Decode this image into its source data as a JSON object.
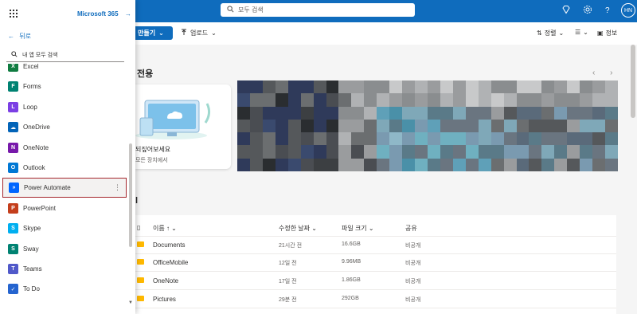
{
  "topbar": {
    "search_placeholder": "모두 검색",
    "avatar_initials": "HN",
    "icons": [
      "diamond-icon",
      "gear-icon",
      "help-icon"
    ]
  },
  "launcher": {
    "m365_label": "Microsoft 365",
    "m365_arrow": "→",
    "back_label": "뒤로",
    "search_placeholder": "내 앱 모두 검색",
    "apps": [
      {
        "label": "Excel",
        "color": "#107c41",
        "glyph": "X"
      },
      {
        "label": "Forms",
        "color": "#008272",
        "glyph": "F"
      },
      {
        "label": "Loop",
        "color": "#7b3fe4",
        "glyph": "L"
      },
      {
        "label": "OneDrive",
        "color": "#0364b8",
        "glyph": "☁"
      },
      {
        "label": "OneNote",
        "color": "#7719aa",
        "glyph": "N"
      },
      {
        "label": "Outlook",
        "color": "#0078d4",
        "glyph": "O"
      },
      {
        "label": "Power Automate",
        "color": "#0066ff",
        "glyph": "»"
      },
      {
        "label": "PowerPoint",
        "color": "#c43e1c",
        "glyph": "P"
      },
      {
        "label": "Skype",
        "color": "#00aff0",
        "glyph": "S"
      },
      {
        "label": "Sway",
        "color": "#008272",
        "glyph": "S"
      },
      {
        "label": "Teams",
        "color": "#5059c9",
        "glyph": "T"
      },
      {
        "label": "To Do",
        "color": "#2564cf",
        "glyph": "✓"
      }
    ],
    "more_glyph": "⋮"
  },
  "cmdbar": {
    "create_label": "만들기",
    "create_caret": "⌄",
    "upload_label": "업로드",
    "upload_caret": "⌄",
    "sort_label": "정렬",
    "sort_caret": "⌄",
    "view_caret": "⌄",
    "info_label": "정보"
  },
  "main": {
    "recommended_title": "전용",
    "card_title": "되짚어보세요",
    "card_sub": "모든 장치에서",
    "prev_arrow": "‹",
    "next_arrow": "›",
    "files_marker": "l",
    "columns": [
      "이름 ↑ ⌄",
      "수정한 날짜 ⌄",
      "파일 크기 ⌄",
      "공유"
    ],
    "files": [
      {
        "name": "Documents",
        "modified": "21시간 전",
        "size": "16.6GB",
        "sharing": "비공개"
      },
      {
        "name": "OfficeMobile",
        "modified": "12일 전",
        "size": "9.96MB",
        "sharing": "비공개"
      },
      {
        "name": "OneNote",
        "modified": "17일 전",
        "size": "1.86GB",
        "sharing": "비공개"
      },
      {
        "name": "Pictures",
        "modified": "29분 전",
        "size": "292GB",
        "sharing": "비공개"
      }
    ]
  }
}
